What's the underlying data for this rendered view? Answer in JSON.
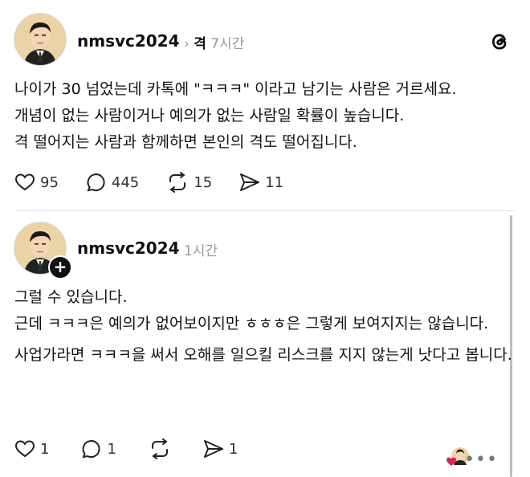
{
  "post1": {
    "username": "nmsvc2024",
    "topic": "격",
    "time": "7시간",
    "lines": [
      "나이가 30 넘었는데 카톡에 \"ㅋㅋㅋ\" 이라고 남기는 사람은 거르세요.",
      "개념이 없는 사람이거나 예의가 없는 사람일 확률이 높습니다.",
      "격 떨어지는 사람과 함께하면 본인의 격도 떨어집니다."
    ],
    "likes": "95",
    "replies": "445",
    "reposts": "15",
    "shares": "11"
  },
  "post2": {
    "username": "nmsvc2024",
    "time": "1시간",
    "paragraphs": [
      "그럴 수 있습니다.",
      "근데 ㅋㅋㅋ은 예의가 없어보이지만 ㅎㅎㅎ은 그렇게 보여지지는 않습니다.",
      "사업가라면 ㅋㅋㅋ을 써서 오해를 일으킬 리스크를 지지 않는게 낫다고 봅니다."
    ],
    "likes": "1",
    "replies": "1",
    "shares": "1"
  },
  "colors": {
    "heart": "#e0245e",
    "muted": "#999999",
    "text": "#111111"
  },
  "icons": [
    "threads-logo-icon",
    "heart-icon",
    "comment-icon",
    "repost-icon",
    "share-icon",
    "more-icon",
    "plus-icon"
  ]
}
